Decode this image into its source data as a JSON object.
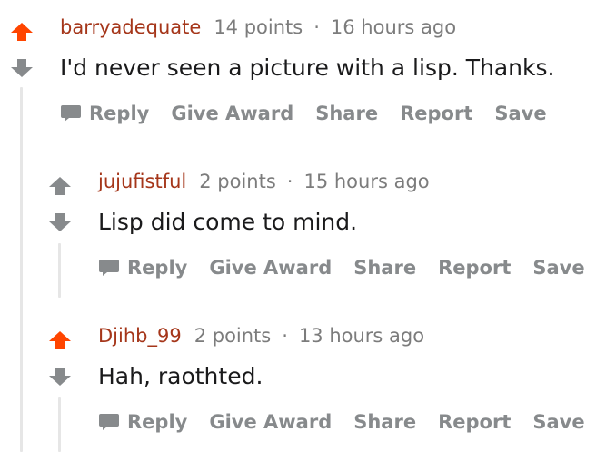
{
  "colors": {
    "upvote": "#ff4500",
    "downvote": "#878a8c",
    "author": "#a5361a",
    "muted": "#7c7c7c",
    "action": "#878a8c",
    "thread_line": "#e6e6e6"
  },
  "comments": [
    {
      "author": "barryadequate",
      "points": "14 points",
      "separator": "·",
      "time": "16 hours ago",
      "body": "I'd never seen a picture with a lisp. Thanks.",
      "upvoted": true,
      "actions": {
        "reply": "Reply",
        "award": "Give Award",
        "share": "Share",
        "report": "Report",
        "save": "Save"
      }
    },
    {
      "author": "jujufistful",
      "points": "2 points",
      "separator": "·",
      "time": "15 hours ago",
      "body": "Lisp did come to mind.",
      "upvoted": false,
      "actions": {
        "reply": "Reply",
        "award": "Give Award",
        "share": "Share",
        "report": "Report",
        "save": "Save"
      }
    },
    {
      "author": "Djihb_99",
      "points": "2 points",
      "separator": "·",
      "time": "13 hours ago",
      "body": "Hah, raothted.",
      "upvoted": true,
      "actions": {
        "reply": "Reply",
        "award": "Give Award",
        "share": "Share",
        "report": "Report",
        "save": "Save"
      }
    }
  ]
}
